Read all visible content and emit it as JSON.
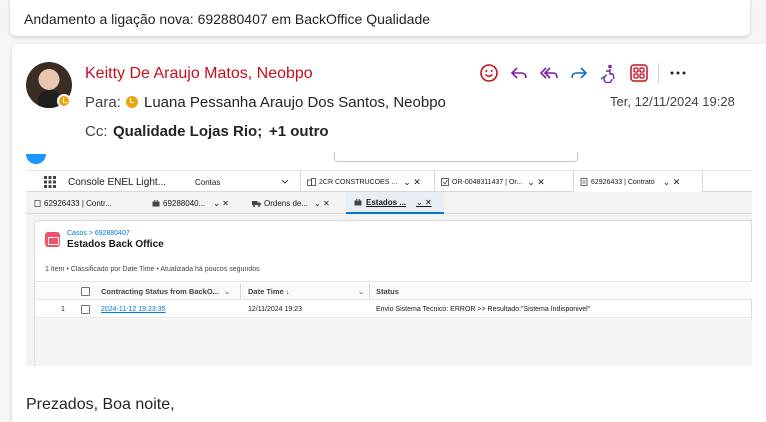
{
  "subject": "Andamento a ligação nova: 692880407 em BackOffice Qualidade",
  "email": {
    "sender": "Keitty De Araujo Matos, Neobpo",
    "to_label": "Para:",
    "to_name": "Luana Pessanha Araujo Dos Santos, Neobpo",
    "cc_label": "Cc:",
    "cc_value": "Qualidade Lojas Rio;",
    "cc_more": "+1 outro",
    "date": "Ter, 12/11/2024 19:28",
    "body_greeting": "Prezados, Boa noite,"
  },
  "actions": [
    "emoji-icon",
    "reply-icon",
    "reply-all-icon",
    "forward-icon",
    "accessibility-icon",
    "apps-icon",
    "more-icon"
  ],
  "colors": {
    "sender": "#c50f1f",
    "accent": "#7a1fa2",
    "presence": "#f0a30a",
    "sf_blue": "#0176d3"
  },
  "screenshot": {
    "app_tab": "Console ENEL Light...",
    "tabs": [
      {
        "label": "Contas"
      },
      {
        "label": "2CR CONSTRUCOES ..."
      },
      {
        "label": "OR-0048311437 | Or..."
      },
      {
        "label": "62926433 | Contrato"
      }
    ],
    "subtabs": [
      {
        "label": "62926433 | Contr..."
      },
      {
        "label": "69288040..."
      },
      {
        "label": "Ordens de..."
      },
      {
        "label": "Estados ..."
      }
    ],
    "breadcrumb": "Casos > 692880407",
    "panel_title": "Estados Back Office",
    "panel_meta": "1 Item • Classificado por Date Time • Atualizada há poucos segundos",
    "columns": [
      "Contracting Status from BackO...",
      "Date Time ↓",
      "Status"
    ],
    "rows": [
      {
        "num": "1",
        "contracting": "2024-11-12 19:23:35",
        "datetime": "12/11/2024 19:23",
        "status": "Envio Sistema Tecnico: ERROR >> Resultado:\"Sistema Indisponivel\""
      }
    ]
  }
}
